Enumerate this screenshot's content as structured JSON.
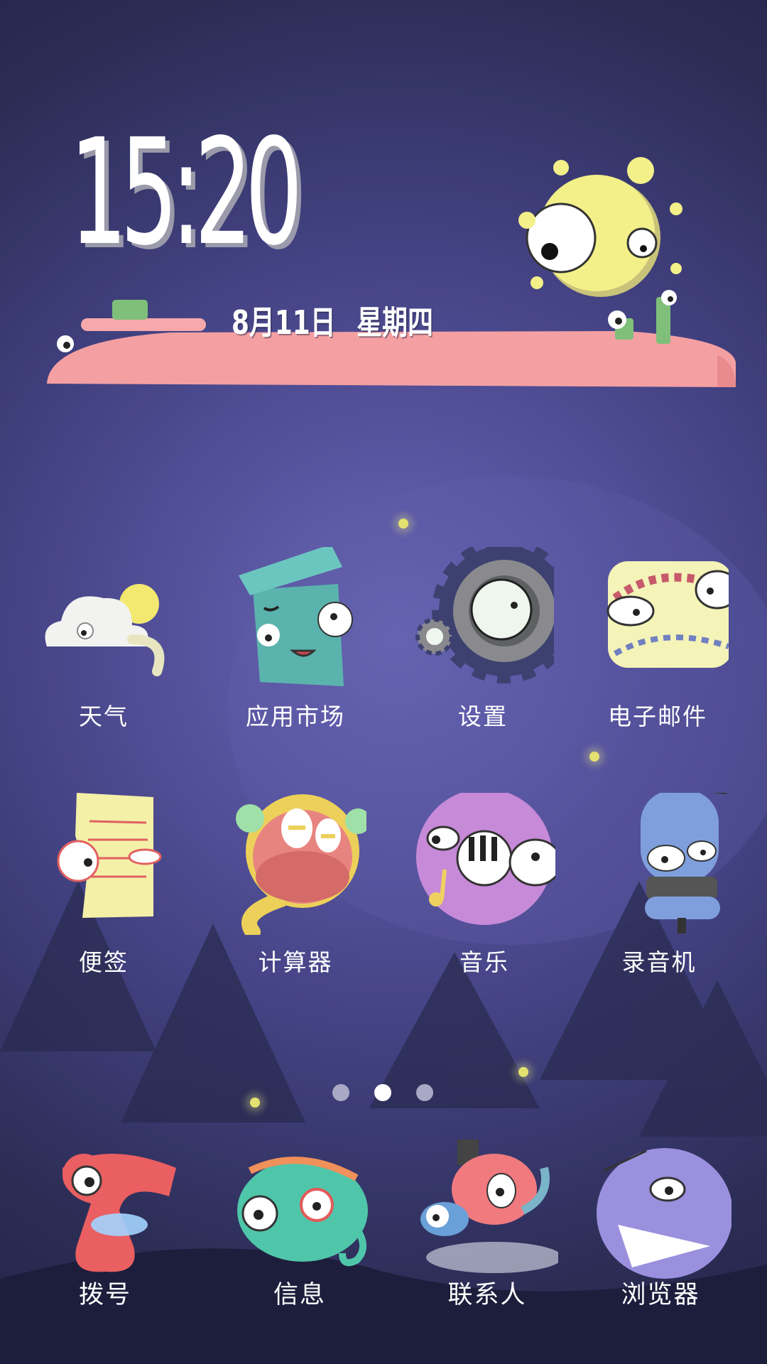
{
  "clock": {
    "time": "15:20",
    "date": "8月11日",
    "weekday": "星期四"
  },
  "apps": [
    {
      "label": "天气",
      "icon": "weather-cloud-icon"
    },
    {
      "label": "应用市场",
      "icon": "app-market-box-icon"
    },
    {
      "label": "设置",
      "icon": "settings-gear-icon"
    },
    {
      "label": "电子邮件",
      "icon": "email-envelope-icon"
    },
    {
      "label": "便签",
      "icon": "notes-paper-icon"
    },
    {
      "label": "计算器",
      "icon": "calculator-monster-icon"
    },
    {
      "label": "音乐",
      "icon": "music-piano-icon"
    },
    {
      "label": "录音机",
      "icon": "recorder-microphone-icon"
    }
  ],
  "dock": [
    {
      "label": "拨号",
      "icon": "phone-dialer-icon"
    },
    {
      "label": "信息",
      "icon": "messages-fish-icon"
    },
    {
      "label": "联系人",
      "icon": "contacts-octopus-icon"
    },
    {
      "label": "浏览器",
      "icon": "browser-monster-icon"
    }
  ],
  "pager": {
    "pages": 3,
    "active": 2
  },
  "colors": {
    "ground": "#f4a0a3",
    "sun": "#f3f08a",
    "label": "#ffffff"
  }
}
